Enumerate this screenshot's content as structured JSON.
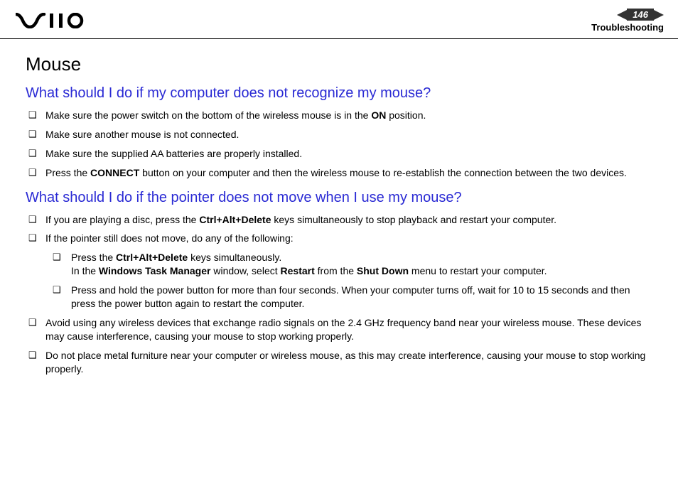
{
  "header": {
    "page_number": "146",
    "section": "Troubleshooting"
  },
  "title": "Mouse",
  "q1": {
    "heading": "What should I do if my computer does not recognize my mouse?",
    "items": {
      "a_pre": "Make sure the power switch on the bottom of the wireless mouse is in the ",
      "a_bold": "ON",
      "a_post": " position.",
      "b": "Make sure another mouse is not connected.",
      "c": "Make sure the supplied AA batteries are properly installed.",
      "d_pre": "Press the ",
      "d_bold": "CONNECT",
      "d_post": " button on your computer and then the wireless mouse to re-establish the connection between the two devices."
    }
  },
  "q2": {
    "heading": "What should I do if the pointer does not move when I use my mouse?",
    "items": {
      "a_pre": "If you are playing a disc, press the ",
      "a_bold": "Ctrl+Alt+Delete",
      "a_post": " keys simultaneously to stop playback and restart your computer.",
      "b": "If the pointer still does not move, do any of the following:",
      "b1_l1_pre": "Press the ",
      "b1_l1_bold": "Ctrl+Alt+Delete",
      "b1_l1_post": " keys simultaneously.",
      "b1_l2_pre": "In the ",
      "b1_l2_b1": "Windows Task Manager",
      "b1_l2_mid1": " window, select ",
      "b1_l2_b2": "Restart",
      "b1_l2_mid2": " from the ",
      "b1_l2_b3": "Shut Down",
      "b1_l2_post": " menu to restart your computer.",
      "b2": "Press and hold the power button for more than four seconds. When your computer turns off, wait for 10 to 15 seconds and then press the power button again to restart the computer.",
      "c": "Avoid using any wireless devices that exchange radio signals on the 2.4 GHz frequency band near your wireless mouse. These devices may cause interference, causing your mouse to stop working properly.",
      "d": "Do not place metal furniture near your computer or wireless mouse, as this may create interference, causing your mouse to stop working properly."
    }
  }
}
